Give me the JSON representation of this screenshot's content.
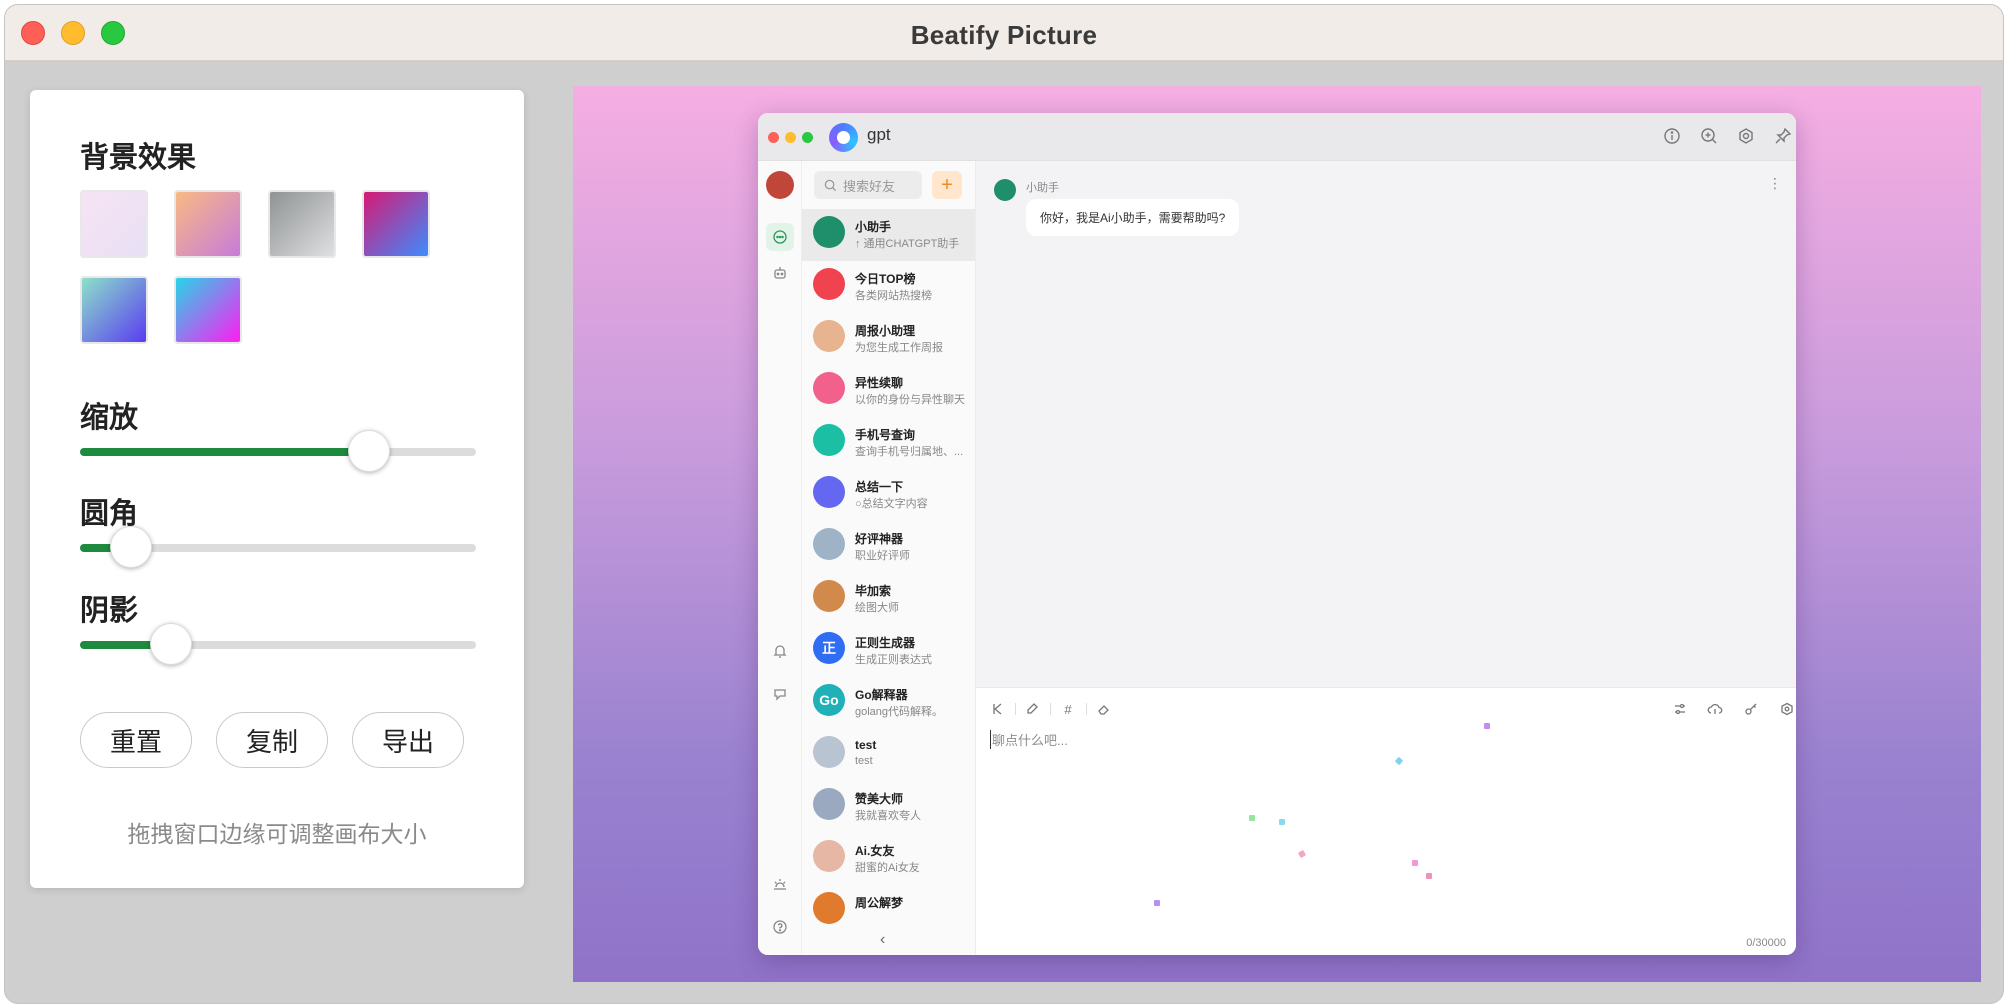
{
  "window": {
    "title": "Beatify Picture"
  },
  "settings": {
    "background_title": "背景效果",
    "swatches": [
      {
        "name": "swatch-pastel-pink",
        "colors": [
          "#f6e4f3",
          "#e8e0f5"
        ]
      },
      {
        "name": "swatch-orange-violet",
        "colors": [
          "#f9b983",
          "#c77bd9"
        ]
      },
      {
        "name": "swatch-gray",
        "colors": [
          "#8f9394",
          "#dfe0e1"
        ]
      },
      {
        "name": "swatch-magenta-blue",
        "colors": [
          "#d61a74",
          "#3d8bff"
        ]
      },
      {
        "name": "swatch-mint-purple",
        "colors": [
          "#8de0c9",
          "#5a3cf0"
        ]
      },
      {
        "name": "swatch-cyan-magenta",
        "colors": [
          "#27d5e8",
          "#ff1df2"
        ]
      }
    ],
    "zoom_title": "缩放",
    "zoom_value": 0.73,
    "radius_title": "圆角",
    "radius_value": 0.13,
    "shadow_title": "阴影",
    "shadow_value": 0.23,
    "reset_label": "重置",
    "copy_label": "复制",
    "export_label": "导出",
    "hint": "拖拽窗口边缘可调整画布大小",
    "accent_color": "#1e8a3e"
  },
  "app": {
    "name": "gpt",
    "search_placeholder": "搜索好友",
    "add_label": "+",
    "contacts": [
      {
        "name": "小助手",
        "desc": "↑ 通用CHATGPT助手",
        "color": "#1f8f6b",
        "initial": "",
        "active": true
      },
      {
        "name": "今日TOP榜",
        "desc": "各类网站热搜榜",
        "color": "#f0424f",
        "initial": "",
        "active": false
      },
      {
        "name": "周报小助理",
        "desc": "为您生成工作周报",
        "color": "#e8b48f",
        "initial": "",
        "active": false
      },
      {
        "name": "异性续聊",
        "desc": "以你的身份与异性聊天",
        "color": "#f2608c",
        "initial": "",
        "active": false
      },
      {
        "name": "手机号查询",
        "desc": "查询手机号归属地、...",
        "color": "#1bbfa3",
        "initial": "",
        "active": false
      },
      {
        "name": "总结一下",
        "desc": "○总结文字内容",
        "color": "#6467ef",
        "initial": "",
        "active": false
      },
      {
        "name": "好评神器",
        "desc": "职业好评师",
        "color": "#9fb3c7",
        "initial": "",
        "active": false
      },
      {
        "name": "毕加索",
        "desc": "绘图大师",
        "color": "#d28a4c",
        "initial": "",
        "active": false
      },
      {
        "name": "正则生成器",
        "desc": "生成正则表达式",
        "color": "#2f6ef2",
        "initial": "正",
        "active": false
      },
      {
        "name": "Go解释器",
        "desc": "golang代码解释。",
        "color": "#1fb0b8",
        "initial": "Go",
        "active": false
      },
      {
        "name": "test",
        "desc": "test",
        "color": "#b9c4d3",
        "initial": "",
        "active": false
      },
      {
        "name": "赞美大师",
        "desc": "我就喜欢夸人",
        "color": "#9aa8c0",
        "initial": "",
        "active": false
      },
      {
        "name": "Ai.女友",
        "desc": "甜蜜的Ai女友",
        "color": "#e7b7a6",
        "initial": "",
        "active": false
      },
      {
        "name": "周公解梦",
        "desc": "",
        "color": "#e07a2c",
        "initial": "",
        "active": false
      }
    ],
    "chat": {
      "bot_name": "小助手",
      "message": "你好，我是Ai小助手，需要帮助吗?",
      "input_placeholder": "聊点什么吧...",
      "counter": "0/30000"
    }
  }
}
